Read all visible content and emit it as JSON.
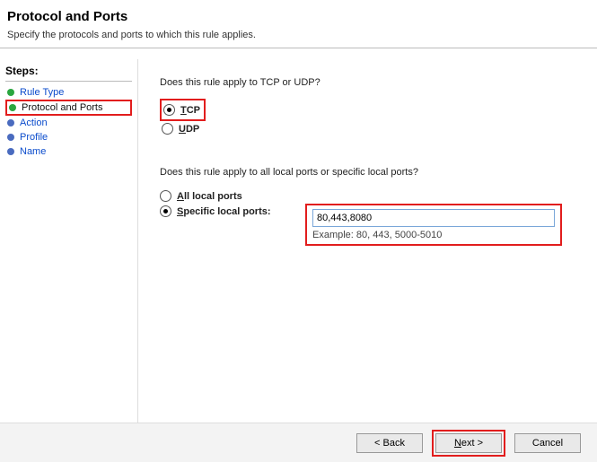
{
  "header": {
    "title": "Protocol and Ports",
    "subtitle": "Specify the protocols and ports to which this rule applies."
  },
  "sidebar": {
    "title": "Steps:",
    "items": [
      {
        "label": "Rule Type",
        "state": "done"
      },
      {
        "label": "Protocol and Ports",
        "state": "current"
      },
      {
        "label": "Action",
        "state": "pending"
      },
      {
        "label": "Profile",
        "state": "pending"
      },
      {
        "label": "Name",
        "state": "pending"
      }
    ]
  },
  "content": {
    "question_protocol": "Does this rule apply to TCP or UDP?",
    "option_tcp_prefix": "T",
    "option_tcp_rest": "CP",
    "option_udp_prefix": "U",
    "option_udp_rest": "DP",
    "question_ports": "Does this rule apply to all local ports or specific local ports?",
    "option_all_prefix": "A",
    "option_all_rest": "ll local ports",
    "option_specific_prefix": "S",
    "option_specific_rest": "pecific local ports:",
    "ports_value": "80,443,8080",
    "ports_example": "Example: 80, 443, 5000-5010"
  },
  "footer": {
    "back": "< Back",
    "next": "Next >",
    "cancel": "Cancel"
  }
}
